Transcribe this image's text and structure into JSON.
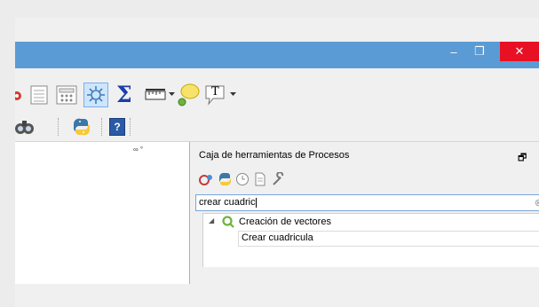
{
  "window": {
    "minimize_label": "–",
    "maximize_label": "❐",
    "close_label": "✕"
  },
  "map": {
    "corner_text": "∞ °"
  },
  "panel": {
    "title": "Caja de herramientas de Procesos",
    "float_icon": "🗗",
    "search_value": "crear cuadric",
    "clear_icon_glyph": "⊗",
    "tree": {
      "expander": "◢",
      "group_label": "Creación de vectores",
      "item_label": "Crear cuadricula"
    }
  },
  "toolbar": {
    "sum_symbol": "Σ",
    "text_annotation_label": "T",
    "help_label": "?"
  },
  "colors": {
    "titlebar": "#5b9bd5",
    "close": "#e81123",
    "qgis_green": "#6fb33e",
    "selection_blue": "#7aa7d6"
  }
}
